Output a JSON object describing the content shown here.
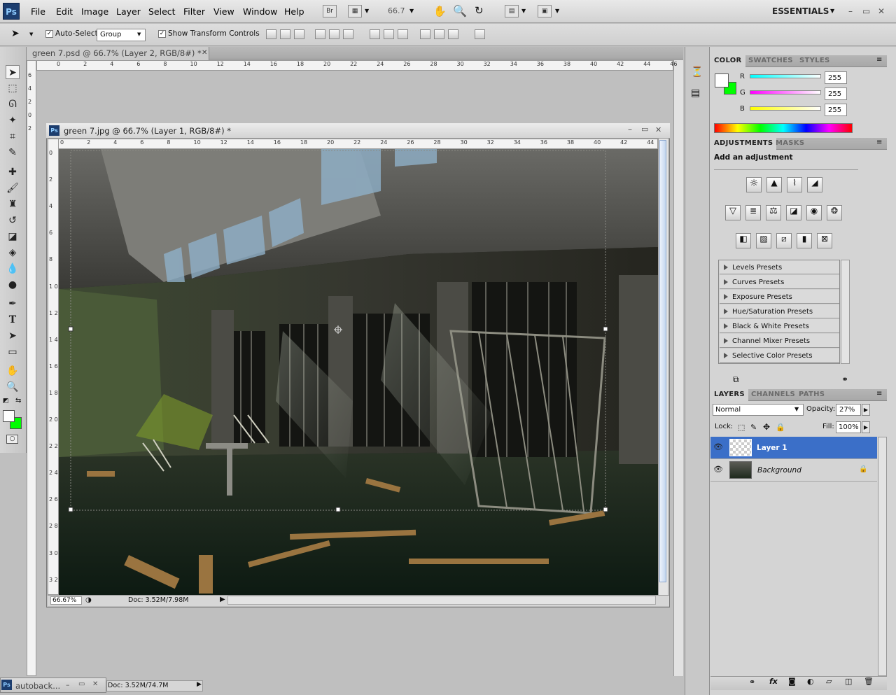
{
  "app": {
    "logo": "Ps",
    "menu": [
      "File",
      "Edit",
      "Image",
      "Layer",
      "Select",
      "Filter",
      "View",
      "Window",
      "Help"
    ],
    "toolbar_icons": [
      "Br",
      "screen-mode",
      "66.7",
      "hand",
      "zoom",
      "rotate",
      "arrange",
      "screen"
    ],
    "zoom": "66.7",
    "workspace": "ESSENTIALS"
  },
  "options": {
    "auto_select_label": "Auto-Select:",
    "auto_select_value": "Group",
    "show_transform_label": "Show Transform Controls"
  },
  "documents": {
    "outer_title": "green 7.psd @ 66.7% (Layer 2, RGB/8#) *",
    "inner_title": "green 7.jpg @ 66.7% (Layer 1, RGB/8#) *",
    "zoom_status": "66.67%",
    "doc_size": "Doc: 3.52M/7.98M",
    "ruler_top": [
      "0",
      "2",
      "4",
      "6",
      "8",
      "10",
      "12",
      "14",
      "16",
      "18",
      "20",
      "22",
      "24",
      "26",
      "28",
      "30",
      "32",
      "34",
      "36",
      "38",
      "40",
      "42",
      "44"
    ],
    "ruler_left": [
      "0",
      "2",
      "4",
      "6",
      "8",
      "1 0",
      "1 2",
      "1 4",
      "1 6",
      "1 8",
      "2 0",
      "2 2",
      "2 4",
      "2 6",
      "2 8",
      "3 0",
      "3 2"
    ],
    "outer_ruler_top": [
      "0",
      "2",
      "4",
      "6",
      "8",
      "10",
      "12",
      "14",
      "16",
      "18",
      "20",
      "22",
      "24",
      "26",
      "28",
      "30",
      "32",
      "34",
      "36",
      "38",
      "40",
      "42",
      "44",
      "46"
    ],
    "outer_ruler_left": [
      "6",
      "4",
      "2",
      "0",
      "2"
    ]
  },
  "minimized": {
    "title": "autoback...",
    "doc_size": "Doc: 3.52M/74.7M"
  },
  "color_panel": {
    "tabs": [
      "COLOR",
      "SWATCHES",
      "STYLES"
    ],
    "channels": [
      {
        "label": "R",
        "value": "255",
        "color": "#00ffff"
      },
      {
        "label": "G",
        "value": "255",
        "color": "#ff00ff"
      },
      {
        "label": "B",
        "value": "255",
        "color": "#ffff00"
      }
    ],
    "foreground": "#ffffff",
    "background": "#00ff00"
  },
  "adjustments_panel": {
    "tabs": [
      "ADJUSTMENTS",
      "MASKS"
    ],
    "heading": "Add an adjustment",
    "presets": [
      "Levels Presets",
      "Curves Presets",
      "Exposure Presets",
      "Hue/Saturation Presets",
      "Black & White Presets",
      "Channel Mixer Presets",
      "Selective Color Presets"
    ]
  },
  "layers_panel": {
    "tabs": [
      "LAYERS",
      "CHANNELS",
      "PATHS"
    ],
    "blend_mode": "Normal",
    "opacity_label": "Opacity:",
    "opacity": "27%",
    "lock_label": "Lock:",
    "fill_label": "Fill:",
    "fill": "100%",
    "layers": [
      {
        "name": "Layer 1",
        "selected": true
      },
      {
        "name": "Background",
        "selected": false
      }
    ]
  }
}
